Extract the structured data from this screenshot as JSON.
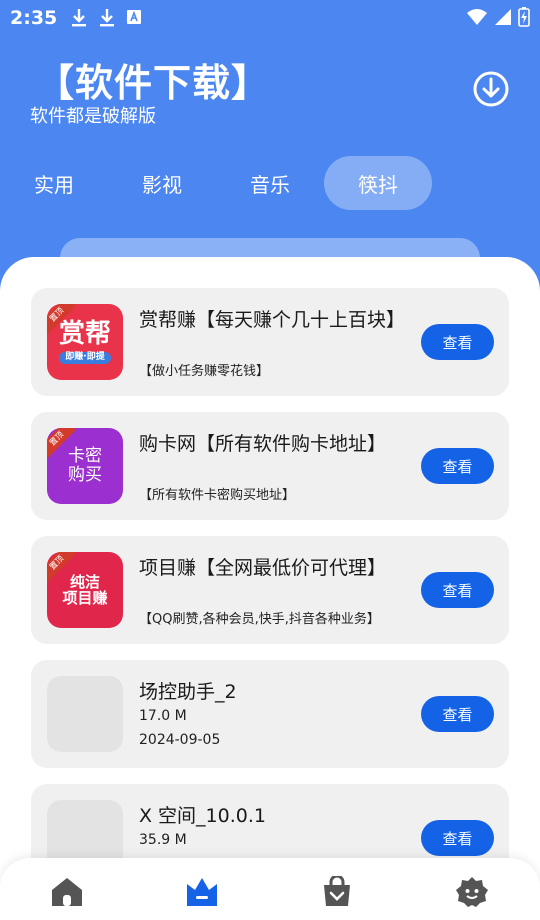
{
  "status_bar": {
    "time": "2:35"
  },
  "header": {
    "title": "【软件下载】",
    "subtitle": "软件都是破解版"
  },
  "tabs": [
    {
      "label": "实用",
      "active": false
    },
    {
      "label": "影视",
      "active": false
    },
    {
      "label": "音乐",
      "active": false
    },
    {
      "label": "筷抖",
      "active": true
    }
  ],
  "colors": {
    "accent": "#4c86f0",
    "button": "#1463e6",
    "card_bg": "#f0f0f0",
    "nav_icon": "#555555",
    "nav_active": "#1463e6"
  },
  "cards": [
    {
      "title": "赏帮赚【每天赚个几十上百块】",
      "desc": "【做小任务赚零花钱】",
      "button": "查看",
      "icon": {
        "line1": "赏帮",
        "line2": "即赚·即提",
        "tag": "置顶",
        "bg": "#e8334a"
      }
    },
    {
      "title": "购卡网【所有软件购卡地址】",
      "desc": "【所有软件卡密购买地址】",
      "button": "查看",
      "icon": {
        "line1": "卡密",
        "line2": "购买",
        "tag": "置顶",
        "bg": "#9b2fd0"
      }
    },
    {
      "title": "项目赚【全网最低价可代理】",
      "desc": "【QQ刷赞,各种会员,快手,抖音各种业务】",
      "button": "查看",
      "icon": {
        "line1": "纯洁",
        "line2": "项目赚",
        "tag": "置顶",
        "bg": "#e0264a"
      }
    },
    {
      "title": "场控助手_2",
      "size": "17.0 M",
      "date": "2024-09-05",
      "button": "查看"
    },
    {
      "title": "X 空间_10.0.1",
      "size": "35.9 M",
      "button": "查看"
    }
  ],
  "bottom_nav": [
    {
      "name": "home-icon",
      "active": false
    },
    {
      "name": "crown-icon",
      "active": true
    },
    {
      "name": "bag-icon",
      "active": false
    },
    {
      "name": "profile-icon",
      "active": false
    }
  ]
}
